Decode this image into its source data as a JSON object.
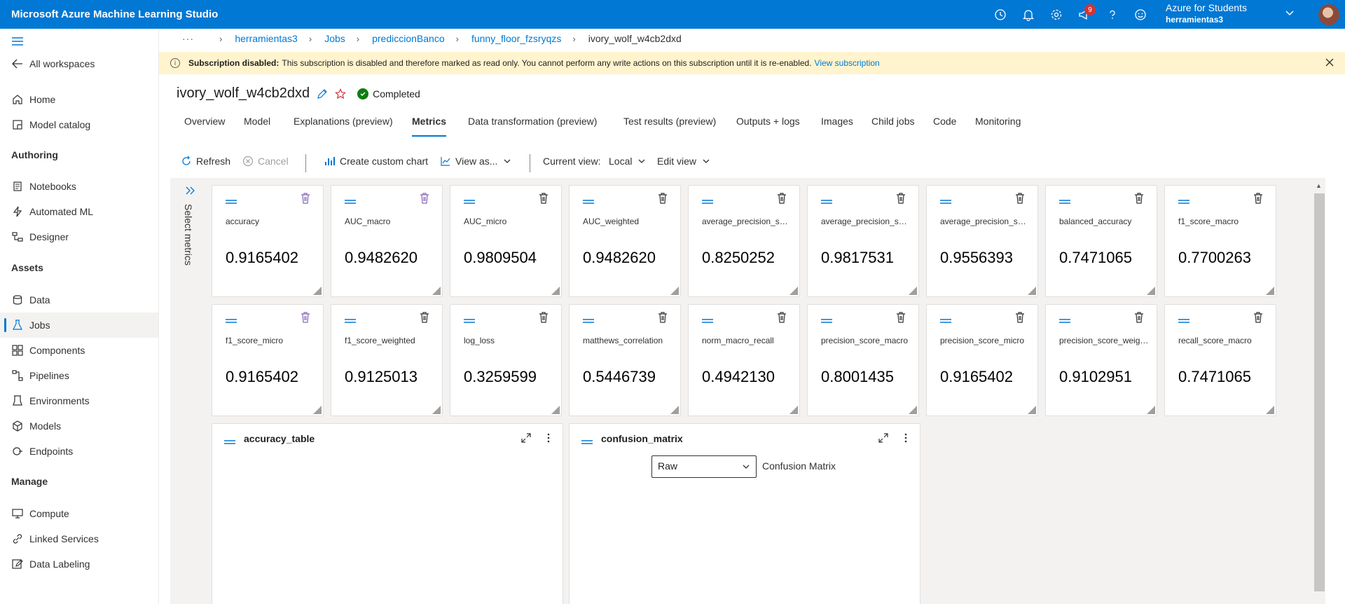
{
  "app": {
    "title": "Microsoft Azure Machine Learning Studio"
  },
  "topbar": {
    "icons": [
      "clock-icon",
      "bell-icon",
      "gear-icon",
      "megaphone-icon",
      "help-icon",
      "smiley-icon"
    ],
    "notification_count": "9",
    "account_name": "Azure for Students",
    "account_workspace": "herramientas3"
  },
  "sidebar": {
    "all_workspaces": "All workspaces",
    "home": "Home",
    "model_catalog": "Model catalog",
    "authoring": "Authoring",
    "notebooks": "Notebooks",
    "automated_ml": "Automated ML",
    "designer": "Designer",
    "assets": "Assets",
    "data": "Data",
    "jobs": "Jobs",
    "components": "Components",
    "pipelines": "Pipelines",
    "environments": "Environments",
    "models": "Models",
    "endpoints": "Endpoints",
    "manage": "Manage",
    "compute": "Compute",
    "linked_services": "Linked Services",
    "data_labeling": "Data Labeling"
  },
  "breadcrumb": {
    "ellipsis": "···",
    "items": [
      "herramientas3",
      "Jobs",
      "prediccionBanco",
      "funny_floor_fzsryqzs",
      "ivory_wolf_w4cb2dxd"
    ]
  },
  "banner": {
    "bold": "Subscription disabled:",
    "message": "This subscription is disabled and therefore marked as read only. You cannot perform any write actions on this subscription until it is re-enabled.",
    "link": "View subscription"
  },
  "job": {
    "name": "ivory_wolf_w4cb2dxd",
    "status": "Completed"
  },
  "tabs": [
    "Overview",
    "Model",
    "Explanations (preview)",
    "Metrics",
    "Data transformation (preview)",
    "Test results (preview)",
    "Outputs + logs",
    "Images",
    "Child jobs",
    "Code",
    "Monitoring"
  ],
  "toolbar": {
    "refresh": "Refresh",
    "cancel": "Cancel",
    "create_chart": "Create custom chart",
    "view_as": "View as...",
    "current_view_label": "Current view:",
    "current_view_value": "Local",
    "edit_view": "Edit view"
  },
  "select_metrics": "Select metrics",
  "metrics": [
    {
      "name": "accuracy",
      "value": "0.9165402"
    },
    {
      "name": "AUC_macro",
      "value": "0.9482620"
    },
    {
      "name": "AUC_micro",
      "value": "0.9809504"
    },
    {
      "name": "AUC_weighted",
      "value": "0.9482620"
    },
    {
      "name": "average_precision_sco...",
      "value": "0.8250252"
    },
    {
      "name": "average_precision_sco...",
      "value": "0.9817531"
    },
    {
      "name": "average_precision_sco...",
      "value": "0.9556393"
    },
    {
      "name": "balanced_accuracy",
      "value": "0.7471065"
    },
    {
      "name": "f1_score_macro",
      "value": "0.7700263"
    },
    {
      "name": "f1_score_micro",
      "value": "0.9165402"
    },
    {
      "name": "f1_score_weighted",
      "value": "0.9125013"
    },
    {
      "name": "log_loss",
      "value": "0.3259599"
    },
    {
      "name": "matthews_correlation",
      "value": "0.5446739"
    },
    {
      "name": "norm_macro_recall",
      "value": "0.4942130"
    },
    {
      "name": "precision_score_macro",
      "value": "0.8001435"
    },
    {
      "name": "precision_score_micro",
      "value": "0.9165402"
    },
    {
      "name": "precision_score_weigh...",
      "value": "0.9102951"
    },
    {
      "name": "recall_score_macro",
      "value": "0.7471065"
    }
  ],
  "panels": {
    "accuracy_table": {
      "title": "accuracy_table"
    },
    "confusion_matrix": {
      "title": "confusion_matrix",
      "select_value": "Raw",
      "label": "Confusion Matrix"
    }
  },
  "colors": {
    "brand": "#0078d4",
    "banner": "#fff4ce",
    "success": "#107c10",
    "delete_accent": "#8764b8"
  }
}
